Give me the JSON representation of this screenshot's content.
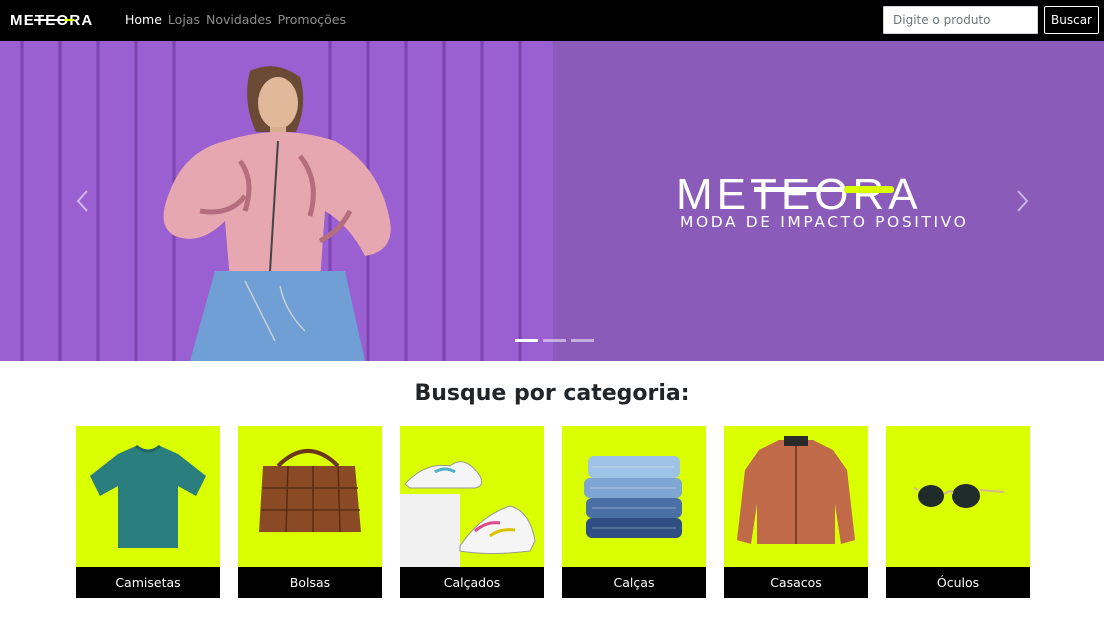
{
  "brand": {
    "name": "METEORA",
    "accent_color": "#d9ff00"
  },
  "nav": {
    "links": [
      {
        "label": "Home",
        "active": true
      },
      {
        "label": "Lojas",
        "active": false
      },
      {
        "label": "Novidades",
        "active": false
      },
      {
        "label": "Promoções",
        "active": false
      }
    ]
  },
  "search": {
    "placeholder": "Digite o produto",
    "value": "",
    "button_label": "Buscar"
  },
  "hero": {
    "logo_text": "METEORA",
    "tagline": "MODA DE IMPACTO POSITIVO",
    "background_color": "#8a5bb9",
    "slides_count": 3,
    "active_slide": 1,
    "prev_icon": "chevron-left-icon",
    "next_icon": "chevron-right-icon"
  },
  "categories": {
    "title": "Busque por categoria:",
    "card_color": "#d9ff00",
    "items": [
      {
        "label": "Camisetas",
        "icon": "tshirt-image"
      },
      {
        "label": "Bolsas",
        "icon": "handbag-image"
      },
      {
        "label": "Calçados",
        "icon": "sneakers-image"
      },
      {
        "label": "Calças",
        "icon": "jeans-stack-image"
      },
      {
        "label": "Casacos",
        "icon": "jacket-image"
      },
      {
        "label": "Óculos",
        "icon": "sunglasses-image"
      }
    ]
  }
}
